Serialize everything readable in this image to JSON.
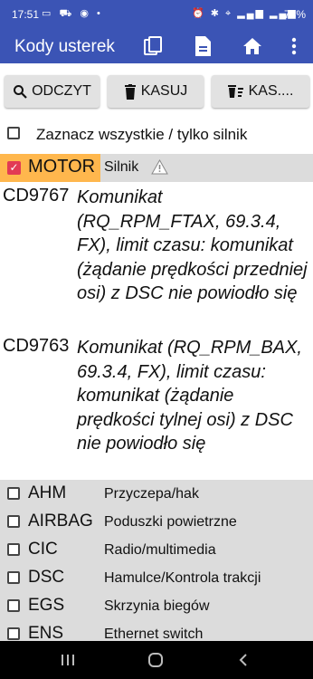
{
  "status_bar": {
    "time": "17:51",
    "battery": "73%"
  },
  "app_bar": {
    "title": "Kody usterek"
  },
  "toolbar": {
    "read_label": "ODCZYT",
    "delete_label": "KASUJ",
    "delete_all_label": "KAS...."
  },
  "select_all": {
    "label": "Zaznacz wszystkie / tylko silnik"
  },
  "motor": {
    "code": "MOTOR",
    "description": "Silnik"
  },
  "errors": [
    {
      "code": "CD9767",
      "message": "Komunikat (RQ_RPM_FTAX, 69.3.4, FX), limit czasu: komunikat (żądanie prędkości przedniej osi) z DSC nie powiodło się"
    },
    {
      "code": "CD9763",
      "message": "Komunikat (RQ_RPM_BAX, 69.3.4, FX), limit czasu: komunikat (żądanie prędkości tylnej osi) z DSC nie powiodło się"
    }
  ],
  "systems": [
    {
      "code": "AHM",
      "description": "Przyczepa/hak"
    },
    {
      "code": "AIRBAG",
      "description": "Poduszki powietrzne"
    },
    {
      "code": "CIC",
      "description": "Radio/multimedia"
    },
    {
      "code": "DSC",
      "description": "Hamulce/Kontrola trakcji"
    },
    {
      "code": "EGS",
      "description": "Skrzynia biegów"
    },
    {
      "code": "ENS",
      "description": "Ethernet switch"
    }
  ],
  "colors": {
    "primary": "#3b54b5",
    "motor_tag": "#ffb74d",
    "checkbox_checked": "#e23a54",
    "list_bg": "#dcdcdc"
  }
}
